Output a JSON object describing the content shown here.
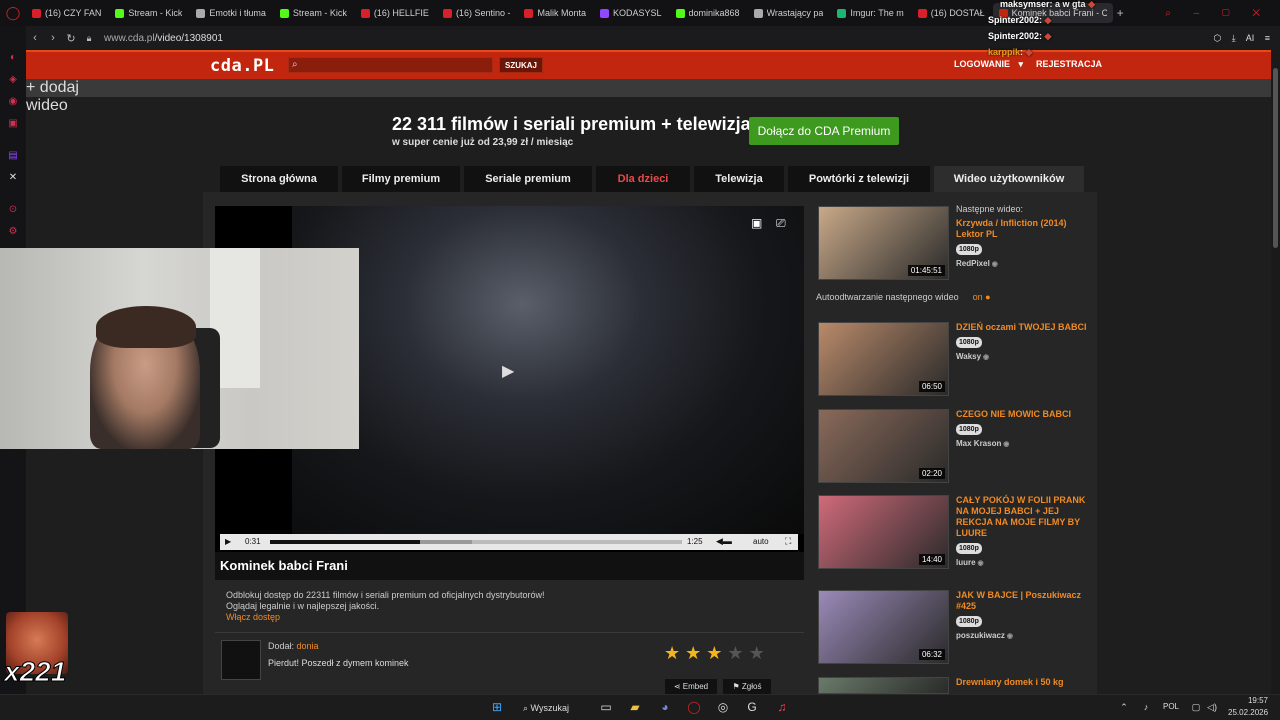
{
  "browser": {
    "tabs": [
      {
        "label": "(16) CZY FAN",
        "color": "#d8202a"
      },
      {
        "label": "Stream - Kick",
        "color": "#53fc18"
      },
      {
        "label": "Emotki i tłuma",
        "color": "#aaaaaa"
      },
      {
        "label": "Stream - Kick",
        "color": "#53fc18"
      },
      {
        "label": "(16) HELLFIE",
        "color": "#d8202a"
      },
      {
        "label": "(16) Sentino -",
        "color": "#d8202a"
      },
      {
        "label": "Malik Monta",
        "color": "#d8202a"
      },
      {
        "label": "KODASYSL",
        "color": "#9146ff"
      },
      {
        "label": "dominika868",
        "color": "#53fc18"
      },
      {
        "label": "Wrastający pa",
        "color": "#aaaaaa"
      },
      {
        "label": "Imgur: The m",
        "color": "#1bb76e"
      },
      {
        "label": "(16) DOSTAŁ",
        "color": "#d8202a"
      },
      {
        "label": "Kominek babci Frani - CD",
        "color": "#c3260e",
        "active": true
      }
    ],
    "url_host": "www.cda.pl",
    "url_path": "/video/1308901",
    "extensions_ai": "AI"
  },
  "chat": {
    "lines": [
      {
        "user": "maksymser",
        "text": ": a w gta"
      },
      {
        "user": "Spinter2002",
        "text": ":"
      },
      {
        "user": "Spinter2002",
        "text": ":"
      },
      {
        "user": "karppik",
        "text": ":"
      }
    ]
  },
  "cda": {
    "logo": "cda.PL",
    "search_button": "SZUKAJ",
    "login": "LOGOWANIE",
    "register": "REJESTRACJA",
    "add_video": "+ dodaj wideo",
    "promo": {
      "headline": "22 311 filmów i seriali premium + telewizja",
      "sub": "w super cenie już od 23,99 zł / miesiąc",
      "button": "Dołącz do CDA Premium"
    },
    "nav": [
      {
        "label": "Strona główna",
        "w": 118
      },
      {
        "label": "Filmy premium",
        "w": 118
      },
      {
        "label": "Seriale premium",
        "w": 128
      },
      {
        "label": "Dla dzieci",
        "w": 94
      },
      {
        "label": "Telewizja",
        "w": 90
      },
      {
        "label": "Powtórki z telewizji",
        "w": 142
      },
      {
        "label": "Wideo użytkowników",
        "w": 150,
        "active": true
      }
    ],
    "player": {
      "current_time": "0:31",
      "duration": "1:25",
      "quality": "auto",
      "progress": 0.365,
      "buffered": 0.49
    },
    "video_title": "Kominek babci Frani",
    "info_line1": "Odblokuj dostęp do 22311 filmów i seriali premium od oficjalnych dystrybutorów!",
    "info_line2": "Oglądaj legalnie i w najlepszej jakości.",
    "info_link": "Włącz dostęp",
    "added_label": "Dodał:",
    "added_user": "donia",
    "description": "Pierdut! Poszedł z dymem kominek",
    "rating": 3,
    "embed": "Embed",
    "report": "Zgłoś",
    "next_label": "Następne wideo:",
    "autoplay_label": "Autoodtwarzanie następnego wideo",
    "autoplay_state": "on",
    "sidebar_videos": [
      {
        "title": "Krzywda / Infliction (2014) Lektor PL",
        "quality": "1080p",
        "channel": "RedPixel",
        "duration": "01:45:51",
        "thumb": "#c9a989"
      },
      {
        "title": "DZIEŃ oczami TWOJEJ BABCI",
        "quality": "1080p",
        "channel": "Waksy",
        "duration": "06:50",
        "thumb": "#b98a6a"
      },
      {
        "title": "CZEGO NIE MOWIC BABCI",
        "quality": "1080p",
        "channel": "Max Krason",
        "duration": "02:20",
        "thumb": "#8a6a5a"
      },
      {
        "title": "CAŁY POKÓJ W FOLII PRANK NA MOJEJ BABCI + JEJ REKCJA NA MOJE FILMY BY LUURE",
        "quality": "1080p",
        "channel": "luure",
        "duration": "14:40",
        "thumb": "#d06a7a"
      },
      {
        "title": "JAK W BAJCE | Poszukiwacz #425",
        "quality": "1080p",
        "channel": "poszukiwacz",
        "duration": "06:32",
        "thumb": "#9a8ab8"
      },
      {
        "title": "Drewniany domek i 50 kg",
        "quality": "",
        "channel": "",
        "duration": "",
        "thumb": "#6a7a6a"
      }
    ]
  },
  "overlay": {
    "counter": "x221"
  },
  "taskbar": {
    "search": "Wyszukaj",
    "lang": "POL",
    "time": "19:57",
    "date": "25.02.2026"
  }
}
